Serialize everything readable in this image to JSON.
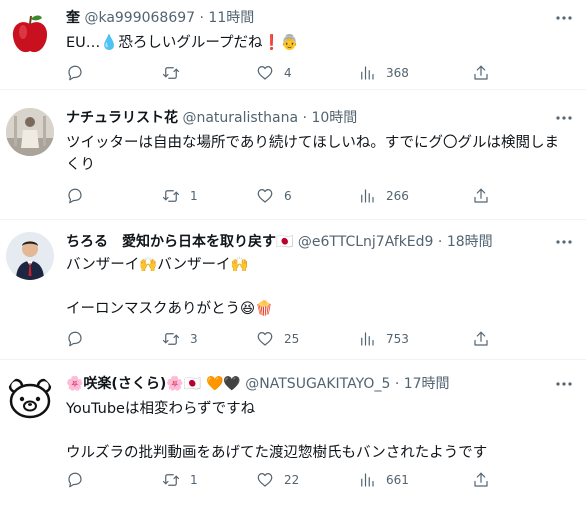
{
  "tweets": [
    {
      "name": "奎",
      "handle": "@ka999068697",
      "time": "11時間",
      "text": "EU…💧恐ろしいグループだね❗👵",
      "replies": "",
      "retweets": "",
      "likes": "4",
      "views": "368"
    },
    {
      "name": "ナチュラリスト花",
      "handle": "@naturalisthana",
      "time": "10時間",
      "text": "ツイッターは自由な場所であり続けてほしいね。すでにグ〇グルは検閲しまくり",
      "replies": "",
      "retweets": "1",
      "likes": "6",
      "views": "266"
    },
    {
      "name": "ちろる　愛知から日本を取り戻す🇯🇵",
      "handle": "@e6TTCLnj7AfkEd9",
      "time": "18時間",
      "text": "バンザーイ🙌バンザーイ🙌\n\nイーロンマスクありがとう😆🍿",
      "replies": "",
      "retweets": "3",
      "likes": "25",
      "views": "753"
    },
    {
      "name": "🌸咲楽(さくら)🌸🇯🇵 🧡🖤",
      "handle": "@NATSUGAKITAYO_5",
      "time": "17時間",
      "text": "YouTubeは相変わらずですね\n\nウルズラの批判動画をあげてた渡辺惣樹氏もバンされたようです",
      "replies": "",
      "retweets": "1",
      "likes": "22",
      "views": "661"
    }
  ],
  "separator": "·",
  "icons": {
    "reply": "reply-icon",
    "retweet": "retweet-icon",
    "like": "heart-icon",
    "views": "views-icon",
    "share": "share-icon",
    "more": "more-icon"
  },
  "colors": {
    "text": "#0f1419",
    "secondary": "#536471",
    "divider": "#eff3f4"
  }
}
